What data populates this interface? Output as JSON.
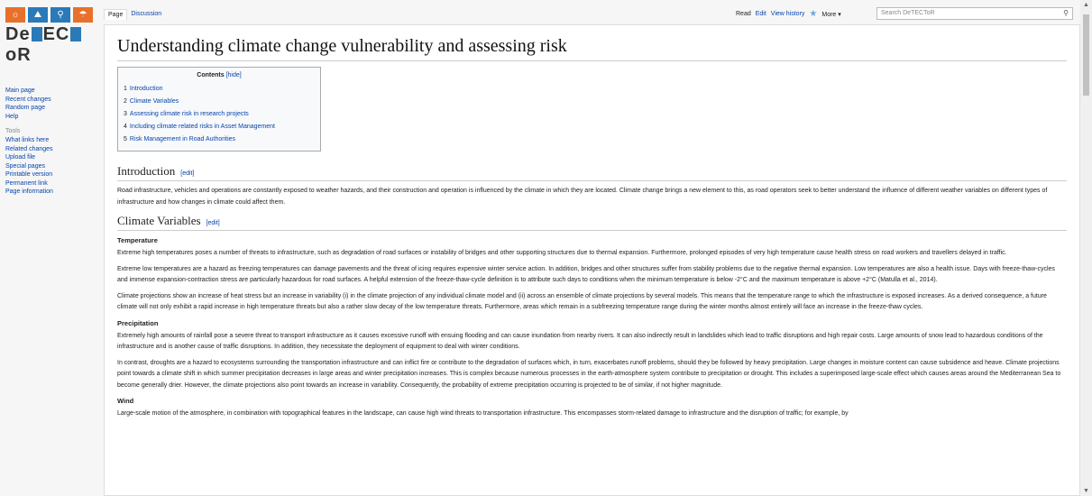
{
  "logo": {
    "tiles": [
      {
        "glyph": "☼",
        "color": "#e8702a"
      },
      {
        "glyph": "⛰",
        "color": "#2a7ab8"
      },
      {
        "glyph": "⚲",
        "color": "#2a7ab8"
      },
      {
        "glyph": "☂",
        "color": "#e8702a"
      }
    ],
    "text_a": "De",
    "text_b": "EC",
    "text_c": "oR"
  },
  "sidebar": {
    "nav": [
      "Main page",
      "Recent changes",
      "Random page",
      "Help"
    ],
    "tools_heading": "Tools",
    "tools": [
      "What links here",
      "Related changes",
      "Upload file",
      "Special pages",
      "Printable version",
      "Permanent link",
      "Page information"
    ]
  },
  "tabs": {
    "page": "Page",
    "discussion": "Discussion",
    "read": "Read",
    "edit": "Edit",
    "history": "View history",
    "more": "More ▾"
  },
  "search": {
    "placeholder": "Search DeTECToR"
  },
  "article": {
    "title": "Understanding climate change vulnerability and assessing risk",
    "toc": {
      "heading": "Contents",
      "hide": "[hide]",
      "items": [
        {
          "num": "1",
          "label": "Introduction"
        },
        {
          "num": "2",
          "label": "Climate Variables"
        },
        {
          "num": "3",
          "label": "Assessing climate risk in research projects"
        },
        {
          "num": "4",
          "label": "Including climate related risks in Asset Management"
        },
        {
          "num": "5",
          "label": "Risk Management in Road Authorities"
        }
      ]
    },
    "edit_label": "[edit]",
    "intro_heading": "Introduction",
    "intro_text": "Road infrastructure, vehicles and operations are constantly exposed to weather hazards, and their construction and operation is influenced by the climate in which they are located. Climate change brings a new element to this, as road operators seek to better understand the influence of different weather variables on different types of infrastructure and how changes in climate could affect them.",
    "climate_heading": "Climate Variables",
    "temperature_heading": "Temperature",
    "temp_p1": "Extreme high temperatures poses a number of threats to infrastructure, such as degradation of road surfaces or instability of bridges and other supporting structures due to thermal expansion. Furthermore, prolonged episodes of very high temperature cause health stress on road workers and travellers delayed in traffic.",
    "temp_p2": "Extreme low temperatures are a hazard as freezing temperatures can damage pavements and the threat of icing requires expensive winter service action. In addition, bridges and other structures suffer from stability problems due to the negative thermal expansion. Low temperatures are also a health issue. Days with freeze-thaw-cycles and immense expansion-contraction stress are particularly hazardous for road surfaces. A helpful extension of the freeze-thaw-cycle definition is to attribute such days to conditions when the minimum temperature is below -2°C and the maximum temperature is above +2°C (Matulla et al., 2014).",
    "temp_p3": "Climate projections show an increase of heat stress but an increase in variability (i) in the climate projection of any individual climate model and (ii) across an ensemble of climate projections by several models. This means that the temperature range to which the infrastructure is exposed increases. As a derived consequence, a future climate will not only exhibit a rapid increase in high temperature threats but also a rather slow decay of the low temperature threats. Furthermore, areas which remain in a subfreezing temperature range during the winter months almost entirely will face an increase in the freeze-thaw cycles.",
    "precip_heading": "Precipitation",
    "precip_p1": "Extremely high amounts of rainfall pose a severe threat to transport infrastructure as it causes excessive runoff with ensuing flooding and can cause inundation from nearby rivers. It can also indirectly result in landslides which lead to traffic disruptions and high repair costs. Large amounts of snow lead to hazardous conditions of the infrastructure and is another cause of traffic disruptions. In addition, they necessitate the deployment of equipment to deal with winter conditions.",
    "precip_p2": "In contrast, droughts are a hazard to ecosystems surrounding the transportation infrastructure and can inflict fire or contribute to the degradation of surfaces which, in turn, exacerbates runoff problems, should they be followed by heavy precipitation. Large changes in moisture content can cause subsidence and heave. Climate projections point towards a climate shift in which summer precipitation decreases in large areas and winter precipitation increases. This is complex because numerous processes in the earth-atmosphere system contribute to precipitation or drought. This includes a superimposed large-scale effect which causes areas around the Mediterranean Sea to become generally drier. However, the climate projections also point towards an increase in variability. Consequently, the probability of extreme precipitation occurring is projected to be of similar, if not higher magnitude.",
    "wind_heading": "Wind",
    "wind_p1": "Large-scale motion of the atmosphere, in combination with topographical features in the landscape, can cause high wind threats to transportation infrastructure. This encompasses storm-related damage to infrastructure and the disruption of traffic; for example, by"
  }
}
